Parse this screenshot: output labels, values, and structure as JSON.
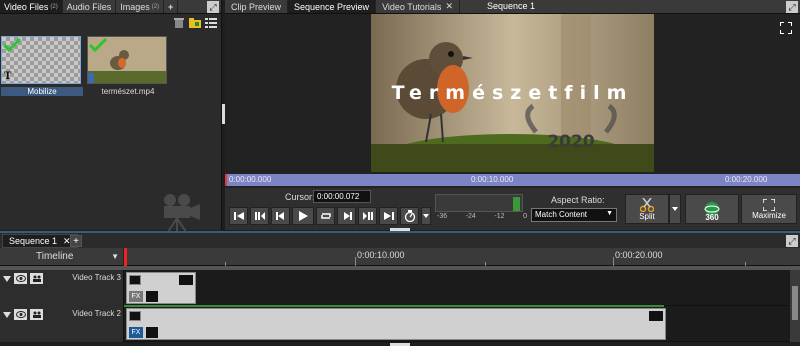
{
  "media_bin": {
    "tabs": [
      {
        "label": "Video Files",
        "count": "(2)",
        "active": true
      },
      {
        "label": "Audio Files",
        "count": "",
        "active": false
      },
      {
        "label": "Images",
        "count": "(2)",
        "active": false
      }
    ],
    "add_tab": "+",
    "clips": [
      {
        "name": "Mobilize",
        "selected": true,
        "kind": "text"
      },
      {
        "name": "természet.mp4",
        "selected": false,
        "kind": "video"
      }
    ]
  },
  "preview": {
    "tabs": [
      {
        "label": "Clip Preview",
        "active": false
      },
      {
        "label": "Sequence Preview",
        "active": true
      },
      {
        "label": "Video Tutorials",
        "active": false,
        "closable": true
      }
    ],
    "title": "Sequence 1",
    "overlay_title": "Természetfilm",
    "overlay_year": "2020",
    "ruler_labels": [
      "0:00:00.000",
      "0:00:10.000",
      "0:00:20.000"
    ],
    "cursor_label": "Cursor:",
    "cursor_value": "0:00:00.072",
    "meter_ticks": [
      "-36",
      "-24",
      "-12",
      "0"
    ],
    "aspect_label": "Aspect Ratio:",
    "aspect_value": "Match Content",
    "split_label": "Split",
    "label_360": "360",
    "maximize_label": "Maximize"
  },
  "timeline": {
    "sequence_tab": "Sequence 1",
    "add_tab": "+",
    "header_label": "Timeline",
    "ruler_labels": [
      "0:00:10.000",
      "0:00:20.000"
    ],
    "tracks": [
      {
        "name": "Video Track 3"
      },
      {
        "name": "Video Track 2"
      }
    ],
    "fx_label": "FX"
  },
  "colors": {
    "accent_blue": "#3c5a80",
    "ruler_blue": "#7c84c4",
    "green_check": "#2fc42f",
    "playhead_red": "#e22222"
  }
}
